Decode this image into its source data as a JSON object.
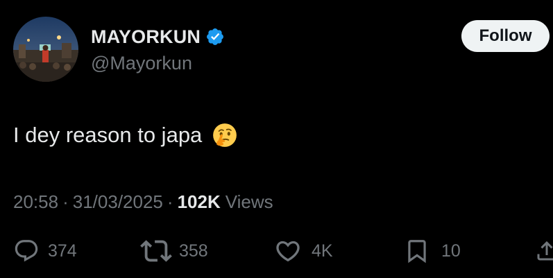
{
  "user": {
    "display_name": "MAYORKUN",
    "handle": "@Mayorkun",
    "verified": true
  },
  "follow_label": "Follow",
  "tweet": {
    "text": "I dey reason to japa",
    "emoji": "thinking-face"
  },
  "meta": {
    "time": "20:58",
    "separator": "·",
    "date": "31/03/2025",
    "views_count": "102K",
    "views_label": "Views"
  },
  "actions": {
    "replies": "374",
    "reposts": "358",
    "likes": "4K",
    "bookmarks": "10"
  },
  "colors": {
    "background": "#000000",
    "primary_text": "#e7e9ea",
    "secondary_text": "#71767b",
    "verified_blue": "#1d9bf0",
    "follow_bg": "#eff3f4"
  }
}
